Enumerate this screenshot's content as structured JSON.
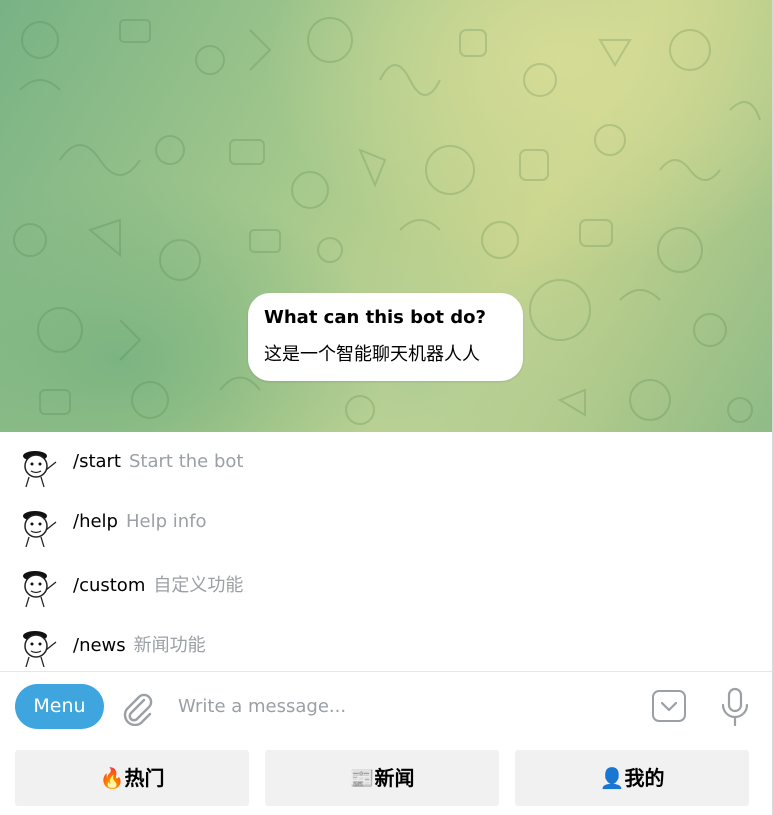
{
  "bot_info": {
    "title": "What can this bot do?",
    "description": "这是一个智能聊天机器人人"
  },
  "commands": [
    {
      "command": "/start",
      "description": "Start the bot"
    },
    {
      "command": "/help",
      "description": "Help info"
    },
    {
      "command": "/custom",
      "description": "自定义功能"
    },
    {
      "command": "/news",
      "description": "新闻功能"
    }
  ],
  "composer": {
    "menu_label": "Menu",
    "placeholder": "Write a message..."
  },
  "reply_keyboard": [
    {
      "label": "🔥热门"
    },
    {
      "label": "📰新闻"
    },
    {
      "label": "👤我的"
    }
  ],
  "colors": {
    "accent": "#3ea5df",
    "command_description": "#9aa0a6",
    "keyboard_button": "#f1f1f1"
  }
}
